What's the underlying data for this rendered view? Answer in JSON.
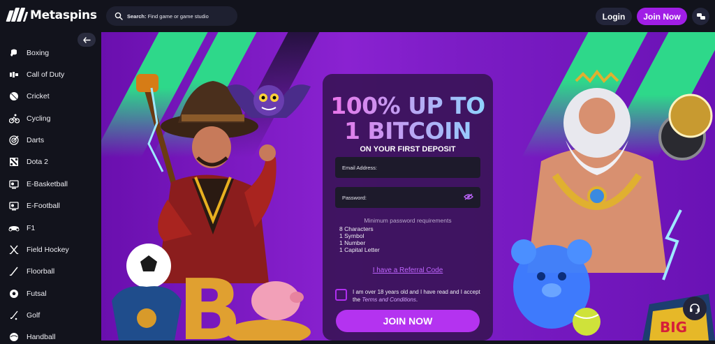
{
  "header": {
    "logo_text": "Metaspins",
    "search_label": "Search:",
    "search_placeholder": "Find game or game studio",
    "login_label": "Login",
    "join_label": "Join Now"
  },
  "sidebar": {
    "collapse_icon": "arrow-left-icon",
    "items": [
      {
        "label": "Boxing",
        "icon": "boxing-icon"
      },
      {
        "label": "Call of Duty",
        "icon": "call-of-duty-icon"
      },
      {
        "label": "Cricket",
        "icon": "cricket-icon"
      },
      {
        "label": "Cycling",
        "icon": "cycling-icon"
      },
      {
        "label": "Darts",
        "icon": "darts-icon"
      },
      {
        "label": "Dota 2",
        "icon": "dota-icon"
      },
      {
        "label": "E-Basketball",
        "icon": "e-basketball-icon"
      },
      {
        "label": "E-Football",
        "icon": "e-football-icon"
      },
      {
        "label": "F1",
        "icon": "f1-icon"
      },
      {
        "label": "Field Hockey",
        "icon": "field-hockey-icon"
      },
      {
        "label": "Floorball",
        "icon": "floorball-icon"
      },
      {
        "label": "Futsal",
        "icon": "futsal-icon"
      },
      {
        "label": "Golf",
        "icon": "golf-icon"
      },
      {
        "label": "Handball",
        "icon": "handball-icon"
      }
    ]
  },
  "promo": {
    "title_line1": "100% UP TO",
    "title_line2": "1 BITCOIN",
    "subtitle": "ON YOUR FIRST DEPOSIT",
    "email_placeholder": "Email Address:",
    "password_placeholder": "Password:",
    "requirements_title": "Minimum password requirements",
    "requirements": [
      "8 Characters",
      "1 Symbol",
      "1 Number",
      "1 Capital Letter"
    ],
    "referral_label": "I have a Referral Code",
    "consent_text": "I am over 18 years old and I have read and I accept the",
    "terms_label": "Terms and Conditions",
    "consent_end": ".",
    "join_label": "JOIN NOW"
  },
  "colors": {
    "accent": "#a01ee6",
    "background": "#12131c",
    "banner_purple": "#8a22d1",
    "stripe_green": "#2ed88a"
  }
}
